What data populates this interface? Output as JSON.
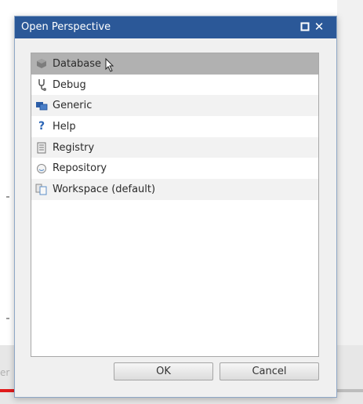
{
  "background": {
    "partial_text": "er",
    "video_progress": 0.21,
    "progress_color": "#e01b1b"
  },
  "dialog": {
    "title": "Open Perspective",
    "title_bar_color": "#2b5898",
    "items": [
      {
        "label": "Database",
        "icon": "database-icon",
        "selected": true
      },
      {
        "label": "Debug",
        "icon": "debug-icon",
        "selected": false
      },
      {
        "label": "Generic",
        "icon": "generic-icon",
        "selected": false
      },
      {
        "label": "Help",
        "icon": "help-icon",
        "selected": false
      },
      {
        "label": "Registry",
        "icon": "registry-icon",
        "selected": false
      },
      {
        "label": "Repository",
        "icon": "repository-icon",
        "selected": false
      },
      {
        "label": "Workspace (default)",
        "icon": "workspace-icon",
        "selected": false
      }
    ],
    "ok_label": "OK",
    "cancel_label": "Cancel"
  }
}
